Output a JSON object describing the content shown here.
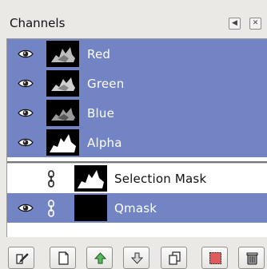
{
  "panel": {
    "title": "Channels",
    "menu_icon": "menu-arrow-icon",
    "close_icon": "close-icon"
  },
  "channels": [
    {
      "label": "Red",
      "visible": true,
      "selected": true
    },
    {
      "label": "Green",
      "visible": true,
      "selected": true
    },
    {
      "label": "Blue",
      "visible": true,
      "selected": true
    },
    {
      "label": "Alpha",
      "visible": true,
      "selected": true
    }
  ],
  "custom_channels": [
    {
      "label": "Selection Mask",
      "visible": false,
      "linked": true,
      "selected": false
    },
    {
      "label": "Qmask",
      "visible": true,
      "linked": true,
      "selected": true
    }
  ],
  "toolbar": {
    "buttons": [
      {
        "name": "edit-channel-attributes-button",
        "icon": "edit-attributes-icon"
      },
      {
        "name": "new-channel-button",
        "icon": "new-page-icon"
      },
      {
        "name": "raise-channel-button",
        "icon": "up-arrow-icon"
      },
      {
        "name": "lower-channel-button",
        "icon": "down-arrow-icon"
      },
      {
        "name": "duplicate-channel-button",
        "icon": "duplicate-icon"
      },
      {
        "name": "channel-to-selection-button",
        "icon": "selection-icon"
      },
      {
        "name": "delete-channel-button",
        "icon": "trash-icon"
      }
    ]
  },
  "colors": {
    "selected_row": "#7384c4",
    "panel_bg": "#eae9e6",
    "selection_red": "#e05a5a"
  }
}
